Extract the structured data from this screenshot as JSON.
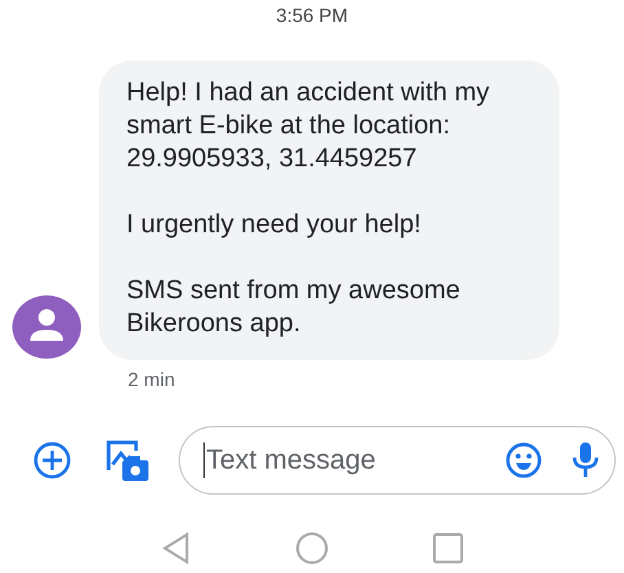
{
  "header": {
    "time": "3:56 PM"
  },
  "message": {
    "paragraphs": [
      "Help! I had an accident with my smart E-bike at the location: 29.9905933, 31.4459257",
      "I urgently need your help!",
      "SMS sent from my awesome Bikeroons app."
    ],
    "age": "2 min"
  },
  "composer": {
    "placeholder": "Text message"
  }
}
